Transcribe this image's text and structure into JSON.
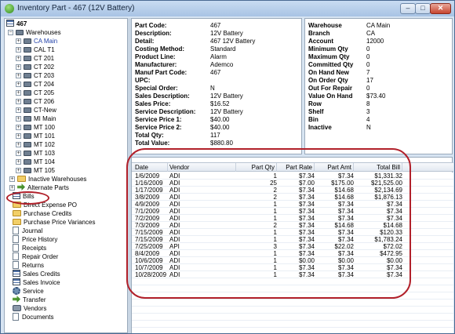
{
  "window": {
    "title": "Inventory Part -  467 (12V Battery)",
    "minimize": "–",
    "maximize": "□",
    "close": "✕"
  },
  "tree": {
    "root": "467",
    "warehouses_label": "Warehouses",
    "warehouses": [
      "CA Main",
      "CAL T1",
      "CT 201",
      "CT 202",
      "CT 203",
      "CT 204",
      "CT 205",
      "CT 206",
      "CT-New",
      "MI Main",
      "MT 100",
      "MT 101",
      "MT 102",
      "MT 103",
      "MT 104",
      "MT 105"
    ],
    "items": [
      "Inactive Warehouses",
      "Alternate Parts",
      "Bills",
      "Direct Expense PO",
      "Purchase Credits",
      "Purchase Price Variances",
      "Journal",
      "Price History",
      "Receipts",
      "Repair Order",
      "Returns",
      "Sales Credits",
      "Sales Invoice",
      "Service",
      "Transfer",
      "Vendors",
      "Documents"
    ]
  },
  "detail": [
    {
      "label": "Part Code:",
      "value": "467"
    },
    {
      "label": "Description:",
      "value": "12V Battery"
    },
    {
      "label": "Detail:",
      "value": "467 12V Battery"
    },
    {
      "label": "Costing Method:",
      "value": "Standard"
    },
    {
      "label": "Product Line:",
      "value": "Alarm"
    },
    {
      "label": "Manufacturer:",
      "value": "Ademco"
    },
    {
      "label": "Manuf Part Code:",
      "value": "467"
    },
    {
      "label": "UPC:",
      "value": ""
    },
    {
      "label": "Special Order:",
      "value": "N"
    },
    {
      "label": "Sales Description:",
      "value": "12V Battery"
    },
    {
      "label": "Sales Price:",
      "value": "$16.52"
    },
    {
      "label": "Service Description:",
      "value": "12V Battery"
    },
    {
      "label": "Service Price 1:",
      "value": "$40.00"
    },
    {
      "label": "Service Price 2:",
      "value": "$40.00"
    },
    {
      "label": "Total Qty:",
      "value": "117"
    },
    {
      "label": "Total Value:",
      "value": "$880.80"
    }
  ],
  "warehouse_info": [
    {
      "label": "Warehouse",
      "value": "CA Main"
    },
    {
      "label": "Branch",
      "value": "CA"
    },
    {
      "label": "Account",
      "value": "12000"
    },
    {
      "label": "Minimum Qty",
      "value": "0"
    },
    {
      "label": "Maximum Qty",
      "value": "0"
    },
    {
      "label": "Committed Qty",
      "value": "0"
    },
    {
      "label": "On Hand New",
      "value": "7"
    },
    {
      "label": "On Order Qty",
      "value": "17"
    },
    {
      "label": "Out For Repair",
      "value": "0"
    },
    {
      "label": "Value On Hand",
      "value": "$73.40"
    },
    {
      "label": "Row",
      "value": "8"
    },
    {
      "label": "Shelf",
      "value": "3"
    },
    {
      "label": "Bin",
      "value": "4"
    },
    {
      "label": "Inactive",
      "value": "N"
    }
  ],
  "bills": {
    "columns": [
      "Date",
      "Vendor",
      "Part Qty",
      "Part Rate",
      "Part Amt",
      "Total Bill"
    ],
    "rows": [
      [
        "1/6/2009",
        "ADI",
        "1",
        "$7.34",
        "$7.34",
        "$1,331.32"
      ],
      [
        "1/16/2009",
        "ADI",
        "25",
        "$7.00",
        "$175.00",
        "$21,525.00"
      ],
      [
        "1/17/2009",
        "ADI",
        "2",
        "$7.34",
        "$14.68",
        "$2,134.69"
      ],
      [
        "3/8/2009",
        "ADI",
        "2",
        "$7.34",
        "$14.68",
        "$1,876.13"
      ],
      [
        "4/9/2009",
        "ADI",
        "1",
        "$7.34",
        "$7.34",
        "$7.34"
      ],
      [
        "7/1/2009",
        "ADI",
        "1",
        "$7.34",
        "$7.34",
        "$7.34"
      ],
      [
        "7/2/2009",
        "ADI",
        "1",
        "$7.34",
        "$7.34",
        "$7.34"
      ],
      [
        "7/3/2009",
        "ADI",
        "2",
        "$7.34",
        "$14.68",
        "$14.68"
      ],
      [
        "7/15/2009",
        "ADI",
        "1",
        "$7.34",
        "$7.34",
        "$120.33"
      ],
      [
        "7/15/2009",
        "ADI",
        "1",
        "$7.34",
        "$7.34",
        "$1,783.24"
      ],
      [
        "7/25/2009",
        "API",
        "3",
        "$7.34",
        "$22.02",
        "$72.02"
      ],
      [
        "8/4/2009",
        "ADI",
        "1",
        "$7.34",
        "$7.34",
        "$472.95"
      ],
      [
        "10/6/2009",
        "ADI",
        "1",
        "$0.00",
        "$0.00",
        "$0.00"
      ],
      [
        "10/7/2009",
        "ADI",
        "1",
        "$7.34",
        "$7.34",
        "$7.34"
      ],
      [
        "10/28/2009",
        "ADI",
        "1",
        "$7.34",
        "$7.34",
        "$7.34"
      ]
    ]
  }
}
